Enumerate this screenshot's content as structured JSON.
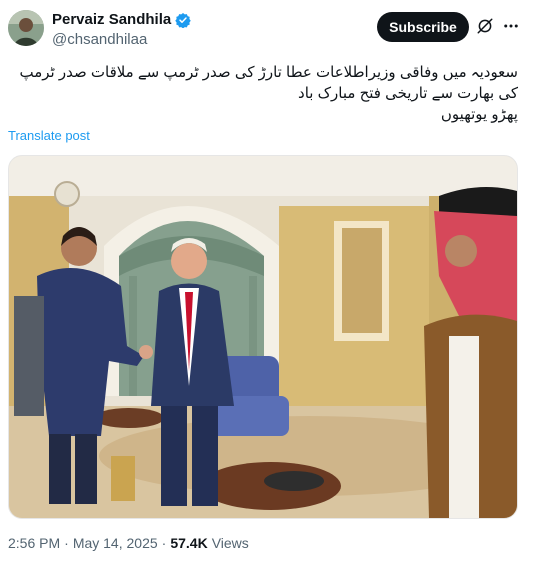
{
  "author": {
    "name": "Pervaiz Sandhila",
    "handle": "@chsandhilaa",
    "verified": true
  },
  "header": {
    "subscribe_label": "Subscribe",
    "grok_icon": "grok-icon",
    "more_icon": "more-icon"
  },
  "post": {
    "lines": [
      "سعودیہ میں وفاقی وزیراطلاعات عطا تارڑ کی صدر ٹرمپ سے ملاقات صدر ٹرمپ",
      "کی بھارت سے تاریخی فتح مبارک باد",
      "پھڑو یوتھیوں"
    ],
    "translate_label": "Translate post"
  },
  "footer": {
    "time": "2:56 PM",
    "separator": "·",
    "date": "May 14, 2025",
    "views_count": "57.4K",
    "views_label": "Views"
  },
  "colors": {
    "link": "#1d9bf0",
    "verified": "#1d9bf0",
    "text": "#0f1419",
    "muted": "#536471",
    "button_bg": "#0f1419"
  }
}
